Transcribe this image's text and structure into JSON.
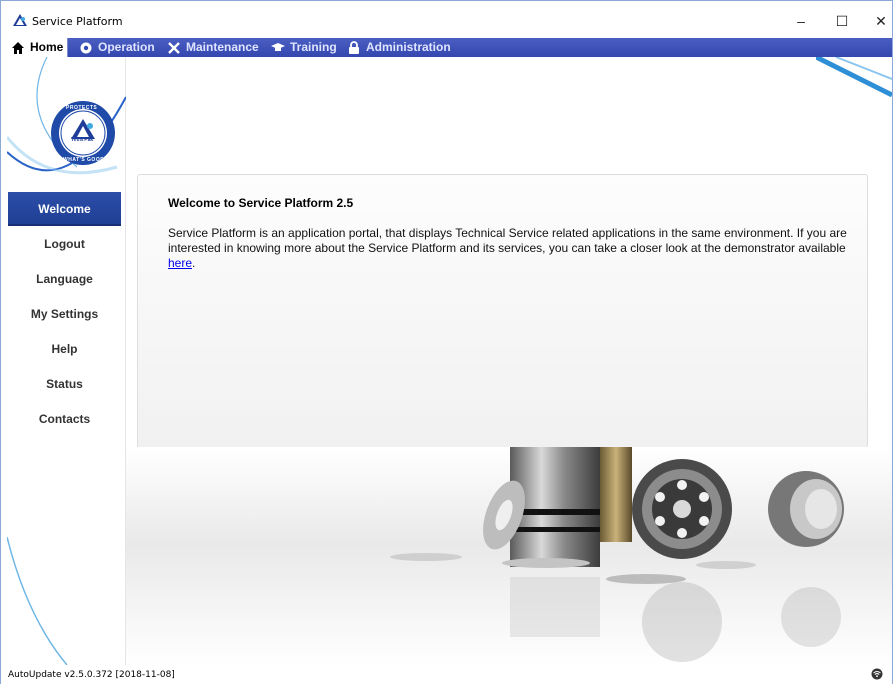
{
  "window": {
    "title": "Service Platform",
    "minimize": "–",
    "maximize": "☐",
    "close": "✕"
  },
  "tabs": [
    {
      "label": "Home",
      "icon": "home-icon"
    },
    {
      "label": "Operation",
      "icon": "gear-icon"
    },
    {
      "label": "Maintenance",
      "icon": "tools-icon"
    },
    {
      "label": "Training",
      "icon": "graduation-cap-icon"
    },
    {
      "label": "Administration",
      "icon": "lock-icon"
    }
  ],
  "logo": {
    "ring_top": "PROTECTS",
    "center": "Tetra Pak",
    "ring_bottom": "WHAT'S GOOD"
  },
  "sidebar": {
    "items": [
      {
        "label": "Welcome",
        "active": true
      },
      {
        "label": "Logout"
      },
      {
        "label": "Language"
      },
      {
        "label": "My Settings"
      },
      {
        "label": "Help"
      },
      {
        "label": "Status"
      },
      {
        "label": "Contacts"
      }
    ]
  },
  "welcome": {
    "title": "Welcome to Service Platform 2.5",
    "text_before_link": "Service Platform is an application portal, that displays Technical Service related applications in the same environment. If you are interested in knowing more about the Service Platform and its services, you can take a closer look at the demonstrator available ",
    "link_text": "here",
    "text_after_link": "."
  },
  "status": {
    "text": "AutoUpdate v2.5.0.372 [2018-11-08]",
    "icon": "network-status-icon"
  },
  "colors": {
    "tab_bar": "#3f51b5",
    "active_nav": "#2c4ea8",
    "link": "#0000ee"
  }
}
